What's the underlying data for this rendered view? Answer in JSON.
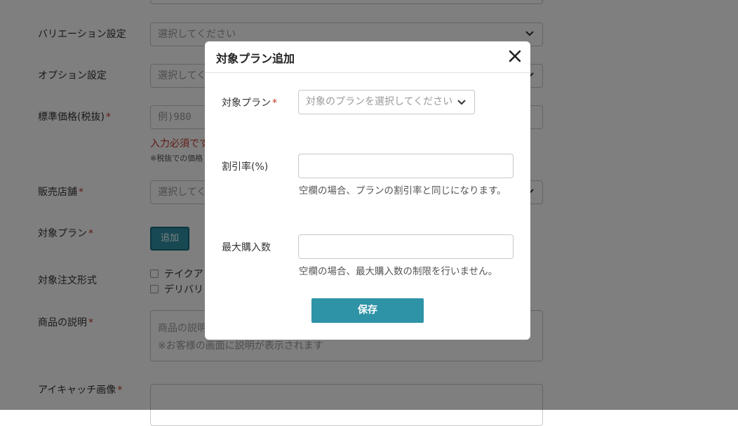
{
  "form": {
    "variation": {
      "label": "バリエーション設定",
      "placeholder": "選択してください"
    },
    "option": {
      "label": "オプション設定",
      "placeholder": "選択してく"
    },
    "price": {
      "label": "標準価格(税抜)",
      "required": "*",
      "placeholder": "例)980",
      "error": "入力必須です",
      "note": "※税抜での価格"
    },
    "store": {
      "label": "販売店舗",
      "required": "*",
      "placeholder": "選択してく"
    },
    "plan": {
      "label": "対象プラン",
      "required": "*",
      "add_button": "追加"
    },
    "order_type": {
      "label": "対象注文形式",
      "options": [
        "テイクア",
        "デリバリ"
      ]
    },
    "description": {
      "label": "商品の説明",
      "required": "*",
      "placeholder_line1": "商品の説明",
      "placeholder_line2": "※お客様の画面に説明が表示されます"
    },
    "eyecatch": {
      "label": "アイキャッチ画像",
      "required": "*"
    }
  },
  "modal": {
    "title": "対象プラン追加",
    "plan": {
      "label": "対象プラン",
      "required": "*",
      "placeholder": "対象のプランを選択してください"
    },
    "discount": {
      "label": "割引率(%)",
      "value": "",
      "help": "空欄の場合、プランの割引率と同じになります。"
    },
    "max_purchase": {
      "label": "最大購入数",
      "value": "",
      "help": "空欄の場合、最大購入数の制限を行いません。"
    },
    "save_label": "保存"
  },
  "icons": {
    "close": "close-icon",
    "chevron": "chevron-down-icon"
  },
  "colors": {
    "accent": "#2e93a7",
    "required": "#c0392b",
    "overlay": "rgba(0,0,0,0.5)"
  }
}
